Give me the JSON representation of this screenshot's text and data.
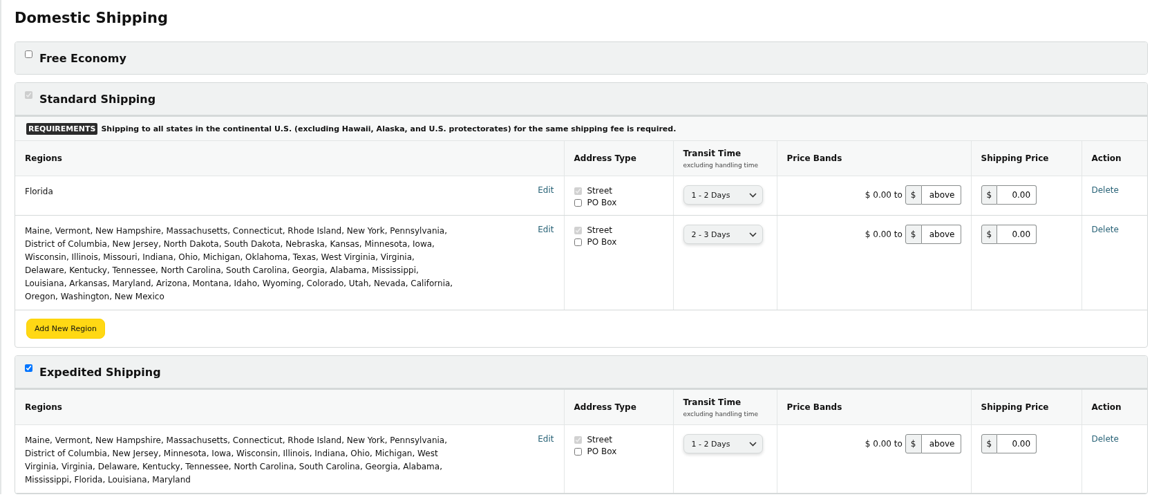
{
  "title": "Domestic Shipping",
  "sections": [
    {
      "name": "Free Economy",
      "checked": false,
      "disabled": false
    },
    {
      "name": "Standard Shipping",
      "checked": true,
      "disabled": true,
      "requirements": {
        "badge": "REQUIREMENTS",
        "text": "Shipping to all states in the continental U.S. (excluding Hawaii, Alaska, and U.S. protectorates) for the same shipping fee is required."
      },
      "columns": [
        {
          "label": "Regions"
        },
        {
          "label": "Address Type"
        },
        {
          "label": "Transit Time",
          "sublabel": "excluding handling time"
        },
        {
          "label": "Price Bands"
        },
        {
          "label": "Shipping Price"
        },
        {
          "label": "Action"
        }
      ],
      "rows": [
        {
          "regions": "Florida",
          "edit": "Edit",
          "address_types": [
            {
              "label": "Street",
              "checked": true,
              "disabled": true
            },
            {
              "label": "PO Box",
              "checked": false,
              "disabled": false
            }
          ],
          "transit": "1 - 2 Days",
          "band_from": "$ 0.00 to",
          "band_currency": "$",
          "band_value": "above",
          "price_currency": "$",
          "price_value": "0.00",
          "action": "Delete"
        },
        {
          "regions": "Maine, Vermont, New Hampshire, Massachusetts, Connecticut, Rhode Island, New York, Pennsylvania, District of Columbia, New Jersey, North Dakota, South Dakota, Nebraska, Kansas, Minnesota, Iowa, Wisconsin, Illinois, Missouri, Indiana, Ohio, Michigan, Oklahoma, Texas, West Virginia, Virginia, Delaware, Kentucky, Tennessee, North Carolina, South Carolina, Georgia, Alabama, Mississippi, Louisiana, Arkansas, Maryland, Arizona, Montana, Idaho, Wyoming, Colorado, Utah, Nevada, California, Oregon, Washington, New Mexico",
          "edit": "Edit",
          "address_types": [
            {
              "label": "Street",
              "checked": true,
              "disabled": true
            },
            {
              "label": "PO Box",
              "checked": false,
              "disabled": false
            }
          ],
          "transit": "2 - 3 Days",
          "band_from": "$ 0.00 to",
          "band_currency": "$",
          "band_value": "above",
          "price_currency": "$",
          "price_value": "0.00",
          "action": "Delete"
        }
      ],
      "add_button": "Add New Region"
    },
    {
      "name": "Expedited Shipping",
      "checked": true,
      "disabled": false,
      "columns": [
        {
          "label": "Regions"
        },
        {
          "label": "Address Type"
        },
        {
          "label": "Transit Time",
          "sublabel": "excluding handling time"
        },
        {
          "label": "Price Bands"
        },
        {
          "label": "Shipping Price"
        },
        {
          "label": "Action"
        }
      ],
      "rows": [
        {
          "regions": "Maine, Vermont, New Hampshire, Massachusetts, Connecticut, Rhode Island, New York, Pennsylvania, District of Columbia, New Jersey, Minnesota, Iowa, Wisconsin, Illinois, Indiana, Ohio, Michigan, West Virginia, Virginia, Delaware, Kentucky, Tennessee, North Carolina, South Carolina, Georgia, Alabama, Mississippi, Florida, Louisiana, Maryland",
          "edit": "Edit",
          "address_types": [
            {
              "label": "Street",
              "checked": true,
              "disabled": true
            },
            {
              "label": "PO Box",
              "checked": false,
              "disabled": false
            }
          ],
          "transit": "1 - 2 Days",
          "band_from": "$ 0.00 to",
          "band_currency": "$",
          "band_value": "above",
          "price_currency": "$",
          "price_value": "0.00",
          "action": "Delete"
        }
      ]
    }
  ]
}
